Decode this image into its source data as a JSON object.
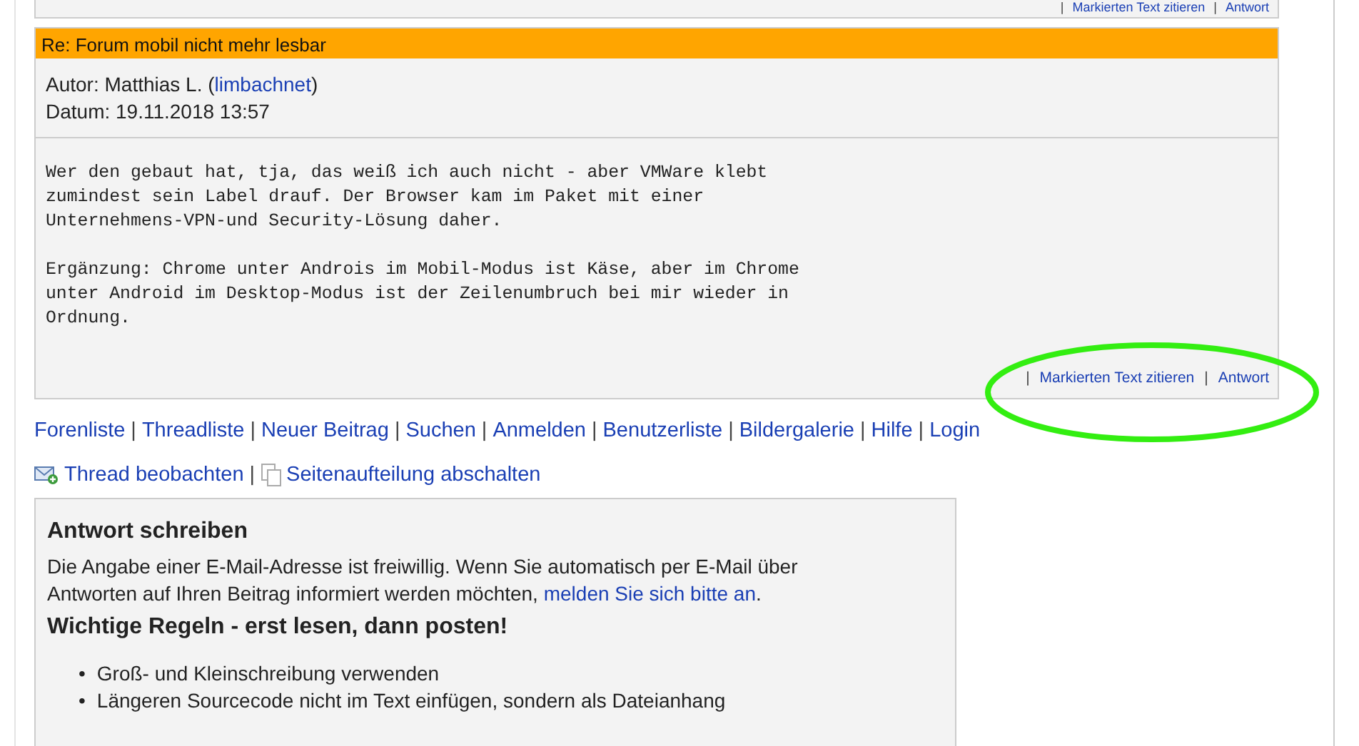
{
  "separator": "|",
  "bullet": "•",
  "previous_post": {
    "actions": [
      "Markierten Text zitieren",
      "Antwort"
    ]
  },
  "post": {
    "title": "Re: Forum mobil nicht mehr lesbar",
    "author_label": "Autor: Matthias L. (",
    "author_link": "limbachnet",
    "author_end": ")",
    "date": "Datum: 19.11.2018 13:57",
    "paragraphs": [
      "Wer den gebaut hat, tja, das weiß ich auch nicht - aber VMWare klebt\nzumindest sein Label drauf. Der Browser kam im Paket mit einer\nUnternehmens-VPN-und Security-Lösung daher.",
      "Ergänzung: Chrome unter Androis im Mobil-Modus ist Käse, aber im Chrome\nunter Android im Desktop-Modus ist der Zeilenumbruch bei mir wieder in\nOrdnung."
    ],
    "actions": [
      "Markierten Text zitieren",
      "Antwort"
    ]
  },
  "nav_links": [
    "Forenliste",
    "Threadliste",
    "Neuer Beitrag",
    "Suchen",
    "Anmelden",
    "Benutzerliste",
    "Bildergalerie",
    "Hilfe",
    "Login"
  ],
  "thread_tools": [
    {
      "kind": "watch",
      "label": "Thread beobachten"
    },
    {
      "kind": "pages",
      "label": "Seitenaufteilung abschalten"
    }
  ],
  "reply": {
    "heading": "Antwort schreiben",
    "intro": "Die Angabe einer E-Mail-Adresse ist freiwillig. Wenn Sie automatisch per E-Mail über Antworten auf Ihren Beitrag informiert werden möchten, ",
    "intro_link": "melden Sie sich bitte an",
    "intro_end": ".",
    "rules_heading": "Wichtige Regeln - erst lesen, dann posten!",
    "rules": [
      "Groß- und Kleinschreibung verwenden",
      "Längeren Sourcecode nicht im Text einfügen, sondern als Dateianhang"
    ]
  }
}
